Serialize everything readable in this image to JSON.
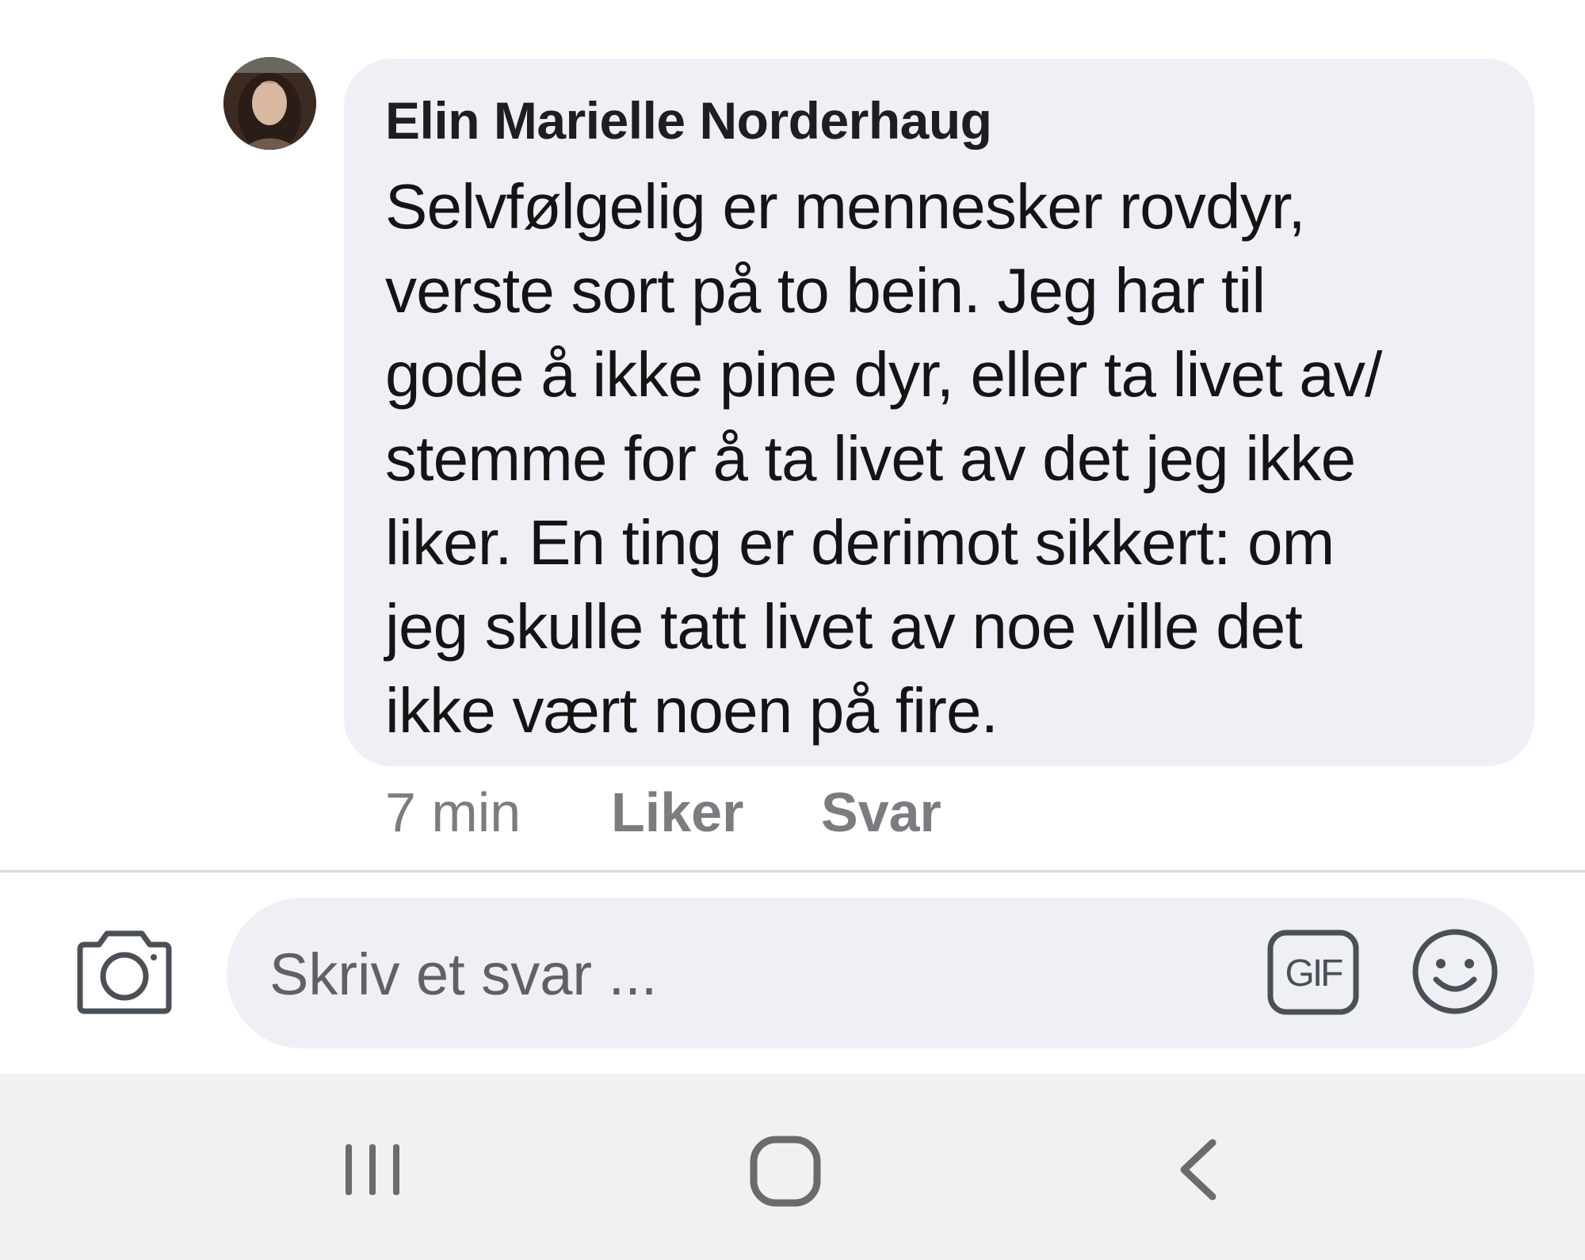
{
  "comment": {
    "author": "Elin Marielle Norderhaug",
    "text_lines": [
      "Selvfølgelig er mennesker rovdyr,",
      "verste sort på to bein. Jeg har til",
      "gode å ikke pine dyr, eller ta livet av/",
      "stemme for å ta livet av det jeg ikke",
      "liker. En ting er derimot sikkert: om",
      "jeg skulle tatt livet av noe ville det",
      "ikke vært noen på fire."
    ],
    "timestamp": "7 min",
    "like_label": "Liker",
    "reply_label": "Svar"
  },
  "composer": {
    "placeholder": "Skriv et svar ...",
    "camera_icon": "camera-icon",
    "gif_label": "GIF",
    "emoji_icon": "smiley-icon"
  },
  "system_nav": {
    "recent_icon": "recent-apps-icon",
    "home_icon": "home-icon",
    "back_icon": "back-icon"
  },
  "colors": {
    "bubble_bg": "#eff0f5",
    "meta_text": "#7a7c80",
    "nav_bg": "#f1f1f1"
  }
}
